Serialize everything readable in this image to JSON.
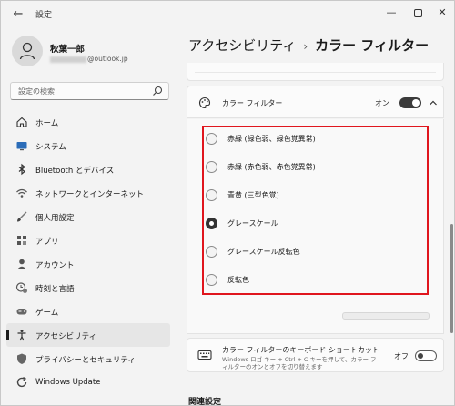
{
  "window": {
    "app_title": "設定",
    "back_symbol": "←",
    "minimize_symbol": "—",
    "close_symbol": "✕"
  },
  "user": {
    "name": "秋葉一郎",
    "email_visible": "@outlook.jp"
  },
  "search": {
    "placeholder": "設定の検索"
  },
  "nav": {
    "items": [
      {
        "label": "ホーム",
        "icon": "home-icon"
      },
      {
        "label": "システム",
        "icon": "system-icon"
      },
      {
        "label": "Bluetooth とデバイス",
        "icon": "bluetooth-icon"
      },
      {
        "label": "ネットワークとインターネット",
        "icon": "wifi-icon"
      },
      {
        "label": "個人用設定",
        "icon": "brush-icon"
      },
      {
        "label": "アプリ",
        "icon": "apps-icon"
      },
      {
        "label": "アカウント",
        "icon": "account-icon"
      },
      {
        "label": "時刻と言語",
        "icon": "time-language-icon"
      },
      {
        "label": "ゲーム",
        "icon": "gamepad-icon"
      },
      {
        "label": "アクセシビリティ",
        "icon": "accessibility-icon",
        "active": true
      },
      {
        "label": "プライバシーとセキュリティ",
        "icon": "shield-icon"
      },
      {
        "label": "Windows Update",
        "icon": "windows-update-icon"
      }
    ]
  },
  "breadcrumb": {
    "parent": "アクセシビリティ",
    "separator": "›",
    "current": "カラー フィルター"
  },
  "color_filters": {
    "title": "カラー フィルター",
    "toggle_state": "オン",
    "toggle_on": true,
    "options": [
      {
        "label": "赤緑 (緑色弱、緑色覚異常)",
        "checked": false
      },
      {
        "label": "赤緑 (赤色弱、赤色覚異常)",
        "checked": false
      },
      {
        "label": "青黄 (三型色覚)",
        "checked": false
      },
      {
        "label": "グレースケール",
        "checked": true
      },
      {
        "label": "グレースケール反転色",
        "checked": false
      },
      {
        "label": "反転色",
        "checked": false
      }
    ]
  },
  "shortcut": {
    "title": "カラー フィルターのキーボード ショートカット",
    "description": "Windows ロゴ キー + Ctrl + C キーを押して、カラー フィルターのオンとオフを切り替えます",
    "toggle_state": "オフ",
    "toggle_on": false
  },
  "related": {
    "heading": "関連設定"
  },
  "colors": {
    "highlight_border": "#e0161e",
    "toggle_on": "#3b3b3b",
    "background": "#f3f3f3"
  }
}
